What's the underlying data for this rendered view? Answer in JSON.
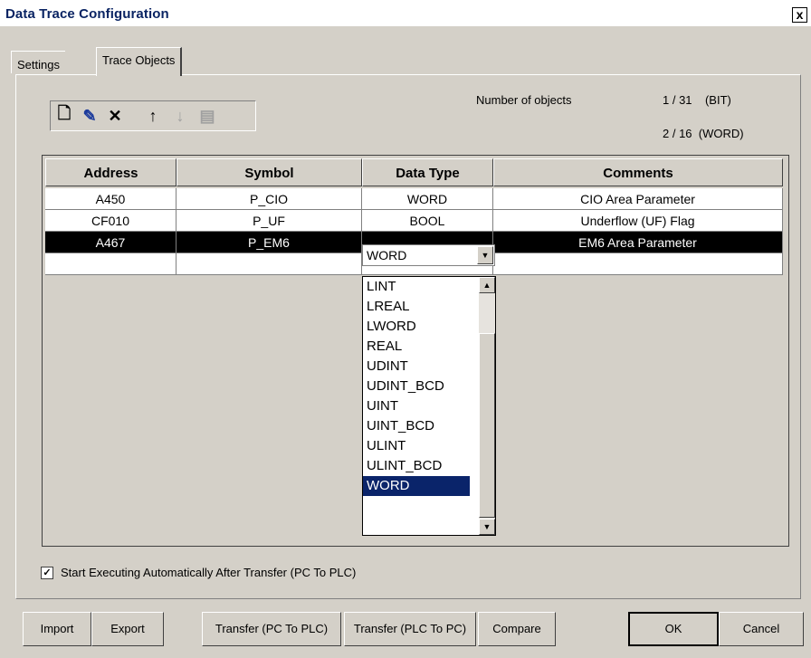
{
  "window": {
    "title": "Data Trace Configuration",
    "close_label": "x"
  },
  "tabs": [
    {
      "label": "Settings"
    },
    {
      "label": "Trace Objects"
    }
  ],
  "toolbar": {
    "buttons": [
      {
        "icon": "new-icon",
        "glyph": "🗋"
      },
      {
        "icon": "edit-icon",
        "glyph": "✎"
      },
      {
        "icon": "delete-icon",
        "glyph": "✕"
      },
      {
        "icon": "move-up-icon",
        "glyph": "↑"
      },
      {
        "icon": "move-down-icon",
        "glyph": "↓"
      },
      {
        "icon": "paste-icon",
        "glyph": "▤"
      }
    ]
  },
  "counts": {
    "label": "Number of objects",
    "bit": "1 / 31    (BIT)",
    "word": "2 / 16  (WORD)"
  },
  "table": {
    "headers": [
      "Address",
      "Symbol",
      "Data Type",
      "Comments"
    ],
    "rows": [
      [
        "A450",
        "P_CIO",
        "WORD",
        "CIO Area Parameter"
      ],
      [
        "CF010",
        "P_UF",
        "BOOL",
        "Underflow (UF) Flag"
      ],
      [
        "A467",
        "P_EM6",
        "WORD",
        "EM6 Area Parameter"
      ],
      [
        "",
        "",
        "",
        ""
      ]
    ]
  },
  "combo": {
    "value": "WORD"
  },
  "dropdown": {
    "options": [
      "LINT",
      "LREAL",
      "LWORD",
      "REAL",
      "UDINT",
      "UDINT_BCD",
      "UINT",
      "UINT_BCD",
      "ULINT",
      "ULINT_BCD",
      "WORD"
    ],
    "highlighted": "WORD"
  },
  "checkbox": {
    "label": "Start Executing Automatically After Transfer (PC To PLC)",
    "checked_glyph": "✓"
  },
  "buttons": {
    "import": "Import",
    "export": "Export",
    "transfer_pc_plc": "Transfer (PC To PLC)",
    "transfer_plc_pc": "Transfer (PLC To PC)",
    "compare": "Compare",
    "ok": "OK",
    "cancel": "Cancel"
  },
  "colors": {
    "selection": "#000000",
    "highlight": "#0a246a",
    "face": "#d4d0c8"
  }
}
